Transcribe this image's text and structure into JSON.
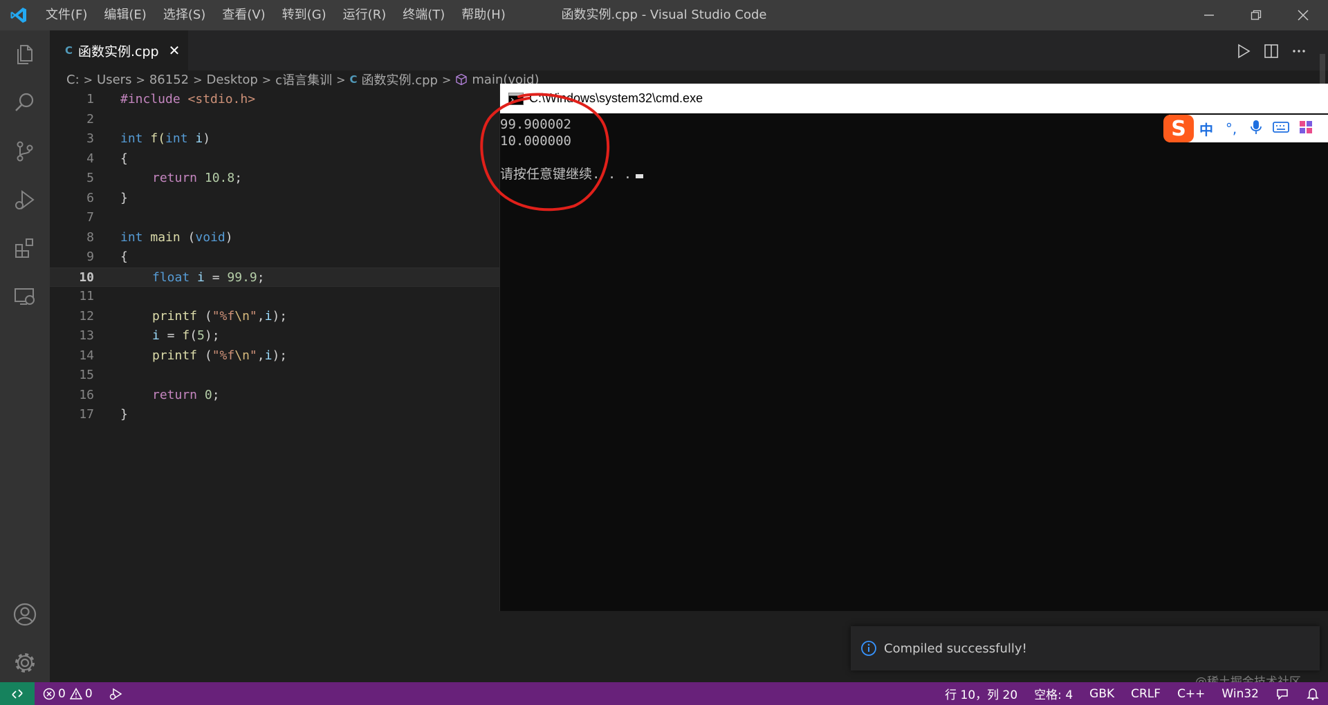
{
  "titlebar": {
    "menus": [
      "文件(F)",
      "编辑(E)",
      "选择(S)",
      "查看(V)",
      "转到(G)",
      "运行(R)",
      "终端(T)",
      "帮助(H)"
    ],
    "title": "函数实例.cpp - Visual Studio Code"
  },
  "tab": {
    "label": "函数实例.cpp",
    "file_icon": "C"
  },
  "breadcrumb": [
    "C:",
    "Users",
    "86152",
    "Desktop",
    "c语言集训",
    "函数实例.cpp",
    "main(void)"
  ],
  "editor": {
    "current_line": 10,
    "lines": [
      {
        "n": "1"
      },
      {
        "n": "2"
      },
      {
        "n": "3"
      },
      {
        "n": "4"
      },
      {
        "n": "5"
      },
      {
        "n": "6"
      },
      {
        "n": "7"
      },
      {
        "n": "8"
      },
      {
        "n": "9"
      },
      {
        "n": "10"
      },
      {
        "n": "11"
      },
      {
        "n": "12"
      },
      {
        "n": "13"
      },
      {
        "n": "14"
      },
      {
        "n": "15"
      },
      {
        "n": "16"
      },
      {
        "n": "17"
      }
    ],
    "code": {
      "l1_a": "#include",
      "l1_b": " <stdio.h>",
      "l3_a": "int",
      "l3_b": " f(",
      "l3_c": "int",
      "l3_d": " i",
      "l3_e": ")",
      "l4": "{",
      "l5_a": "return",
      "l5_b": " 10.8",
      "l5_c": ";",
      "l6": "}",
      "l8_a": "int",
      "l8_b": " main",
      "l8_c": " (",
      "l8_d": "void",
      "l8_e": ")",
      "l9": "{",
      "l10_a": "float",
      "l10_b": " i",
      "l10_c": " = ",
      "l10_d": "99.9",
      "l10_e": ";",
      "l12_a": "printf",
      "l12_b": " (",
      "l12_c": "\"%f",
      "l12_d": "\\n",
      "l12_e": "\"",
      "l12_f": ",",
      "l12_g": "i",
      "l12_h": ");",
      "l13_a": "i",
      "l13_b": " = ",
      "l13_c": "f",
      "l13_d": "(",
      "l13_e": "5",
      "l13_f": ");",
      "l14_a": "printf",
      "l14_b": " (",
      "l14_c": "\"%f",
      "l14_d": "\\n",
      "l14_e": "\"",
      "l14_f": ",",
      "l14_g": "i",
      "l14_h": ");",
      "l16_a": "return",
      "l16_b": " 0",
      "l16_c": ";",
      "l17": "}"
    }
  },
  "cmd": {
    "title": "C:\\Windows\\system32\\cmd.exe",
    "output": [
      "99.900002",
      "10.000000",
      "",
      "请按任意键继续. . ."
    ]
  },
  "ime": {
    "logo": "S",
    "items": [
      "中",
      "°,"
    ]
  },
  "notification": {
    "text": "Compiled successfully!"
  },
  "statusbar": {
    "errors": "0",
    "warnings": "0",
    "position": "行 10，列 20",
    "spaces": "空格: 4",
    "encoding": "GBK",
    "eol": "CRLF",
    "language": "C++",
    "platform": "Win32"
  },
  "watermark": "@稀土掘金技术社区",
  "colors": {
    "statusbar": "#68217a",
    "remote": "#16825d",
    "annotation": "#e0201a"
  }
}
